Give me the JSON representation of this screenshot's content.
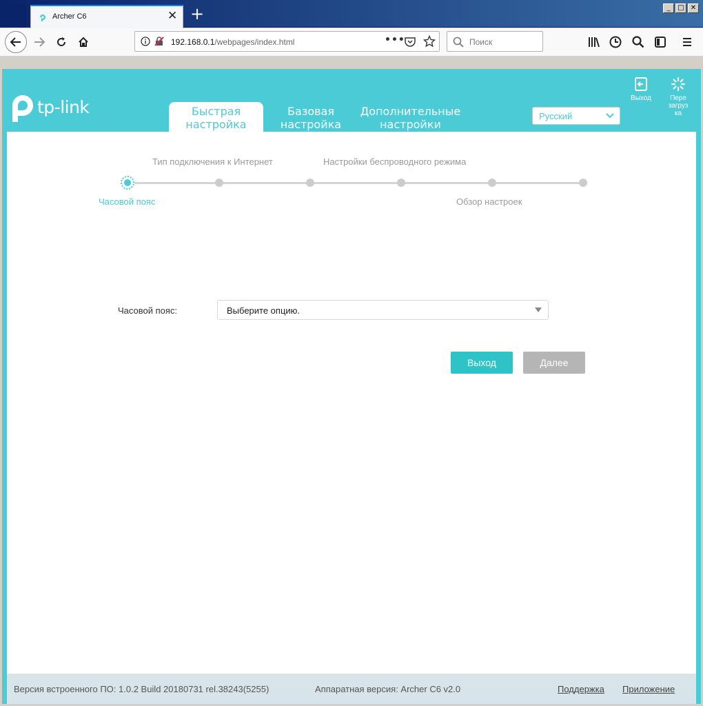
{
  "browser": {
    "tab_title": "Archer C6",
    "tab_close": "✕",
    "new_tab": "+",
    "url_host": "192.168.0.1",
    "url_path": "/webpages/index.html",
    "url_dots": "•••",
    "search_placeholder": "Поиск",
    "window_buttons": [
      "_",
      "□",
      "✕"
    ]
  },
  "router": {
    "logo_text": "tp-link",
    "tabs": [
      {
        "line1": "Быстрая",
        "line2": "настройка",
        "active": true
      },
      {
        "line1": "Базовая",
        "line2": "настройка",
        "active": false
      },
      {
        "line1": "Дополнительные",
        "line2": "настройки",
        "active": false
      }
    ],
    "language": "Русский",
    "logout_label": "Выход",
    "reboot_label_lines": [
      "Пере",
      "загруз",
      "ка"
    ]
  },
  "wizard": {
    "steps_top": [
      "Тип подключения к Интернет",
      "Настройки беспроводного режима"
    ],
    "steps_bottom": [
      "Часовой пояс",
      "Обзор настроек"
    ],
    "active_step": 1,
    "total_steps": 6,
    "timezone_label": "Часовой пояс:",
    "timezone_value": "Выберите опцию.",
    "exit_button": "Выход",
    "next_button": "Далее"
  },
  "footer": {
    "firmware": "Версия встроенного ПО: 1.0.2 Build 20180731 rel.38243(5255)",
    "hardware": "Аппаратная версия: Archer C6 v2.0",
    "support_link": "Поддержка",
    "app_link": "Приложение"
  },
  "colors": {
    "accent": "#4acbd6",
    "button_primary": "#2ec3c6",
    "button_disabled": "#b5b5b5",
    "footer_bg": "#d7e4e9"
  }
}
